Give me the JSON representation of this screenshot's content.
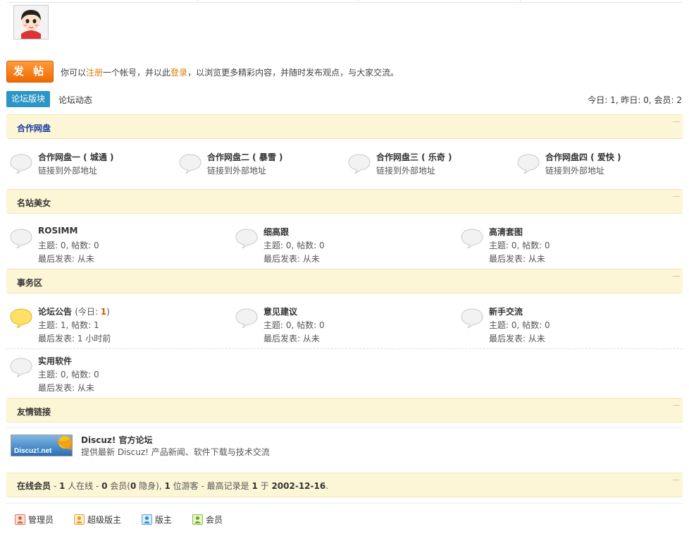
{
  "post_button": "发 帖",
  "notice": {
    "part1": "你可以",
    "register": "注册",
    "part2": "一个帐号，并以此",
    "login": "登录",
    "part3": "，以浏览更多精彩内容，并随时发布观点，与大家交流。"
  },
  "tabs": [
    "论坛版块",
    "论坛动态"
  ],
  "stats": "今日: 1, 昨日: 0, 会员: 2",
  "categories": {
    "partner": {
      "title": "合作网盘",
      "forums": [
        {
          "name": "合作网盘一 ( 城通 )",
          "desc": "链接到外部地址"
        },
        {
          "name": "合作网盘二 ( 暴雪 )",
          "desc": "链接到外部地址"
        },
        {
          "name": "合作网盘三 ( 乐奇 )",
          "desc": "链接到外部地址"
        },
        {
          "name": "合作网盘四 ( 爱快 )",
          "desc": "链接到外部地址"
        }
      ]
    },
    "beauty": {
      "title": "名站美女",
      "forums": [
        {
          "name": "ROSIMM",
          "stats": "主题: 0, 帖数: 0",
          "last": "最后发表: 从未"
        },
        {
          "name": "细高跟",
          "stats": "主题: 0, 帖数: 0",
          "last": "最后发表: 从未"
        },
        {
          "name": "高清套图",
          "stats": "主题: 0, 帖数: 0",
          "last": "最后发表: 从未"
        }
      ]
    },
    "affairs": {
      "title": "事务区",
      "forums": [
        {
          "name": "论坛公告",
          "today_prefix": "(今日: ",
          "today_count": "1",
          "today_suffix": ")",
          "stats": "主题: 1, 帖数: 1",
          "last": "最后发表: 1 小时前"
        },
        {
          "name": "意见建议",
          "stats": "主题: 0, 帖数: 0",
          "last": "最后发表: 从未"
        },
        {
          "name": "新手交流",
          "stats": "主题: 0, 帖数: 0",
          "last": "最后发表: 从未"
        },
        {
          "name": "实用软件",
          "stats": "主题: 0, 帖数: 0",
          "last": "最后发表: 从未"
        }
      ]
    },
    "links": {
      "title": "友情链接",
      "items": [
        {
          "logo_text": "Discuz!.net",
          "name": "Discuz! 官方论坛",
          "desc": "提供最新 Discuz! 产品新闻、软件下载与技术交流"
        }
      ]
    }
  },
  "online": {
    "label": "在线会员",
    "t1": " - ",
    "online_count": "1",
    "t2": " 人在线 - ",
    "member_count": "0",
    "t3": " 会员(",
    "hidden_count": "0",
    "t4": " 隐身), ",
    "guest_count": "1",
    "t5": " 位游客 - 最高记录是 ",
    "record": "1",
    "t6": " 于 ",
    "record_date": "2002-12-16",
    "t7": "."
  },
  "legend": [
    "管理员",
    "超级版主",
    "版主",
    "会员"
  ],
  "colors": {
    "accent_blue": "#2b95c6",
    "post_orange": "#f06a00",
    "category_bg": "#fcf6d6",
    "link_orange": "#d87f0c"
  }
}
